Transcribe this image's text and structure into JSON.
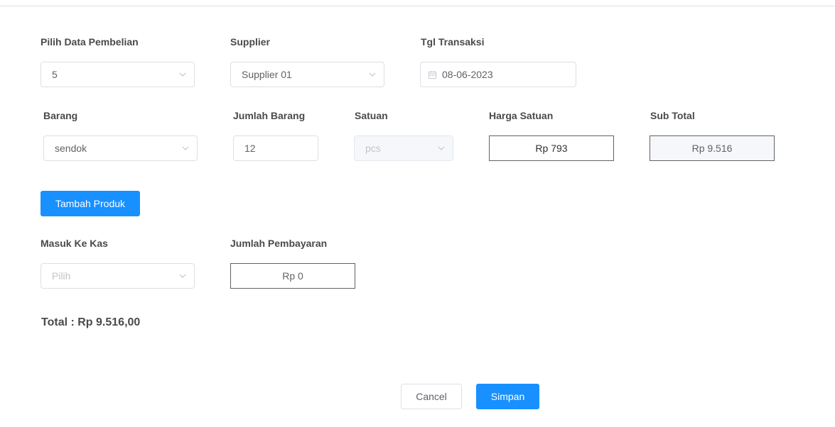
{
  "form": {
    "pembelian": {
      "label": "Pilih Data Pembelian",
      "value": "5"
    },
    "supplier": {
      "label": "Supplier",
      "value": "Supplier 01"
    },
    "tgl": {
      "label": "Tgl Transaksi",
      "value": "08-06-2023"
    }
  },
  "item": {
    "barang": {
      "label": "Barang",
      "value": "sendok"
    },
    "jumlah": {
      "label": "Jumlah Barang",
      "value": "12"
    },
    "satuan": {
      "label": "Satuan",
      "value": "pcs"
    },
    "harga": {
      "label": "Harga Satuan",
      "value": "Rp 793"
    },
    "subtotal": {
      "label": "Sub Total",
      "value": "Rp 9.516"
    }
  },
  "tambah_label": "Tambah Produk",
  "payment": {
    "kas": {
      "label": "Masuk Ke Kas",
      "placeholder": "Pilih"
    },
    "jumlah": {
      "label": "Jumlah Pembayaran",
      "value": "Rp 0"
    }
  },
  "total_text": "Total : Rp 9.516,00",
  "actions": {
    "cancel_label": "Cancel",
    "save_label": "Simpan"
  },
  "colors": {
    "primary": "#1890ff",
    "border": "#dcdfe6",
    "disabled_bg": "#f5f7fa"
  },
  "icons": {
    "select_arrow": "chevron-down-icon",
    "date": "calendar-icon"
  }
}
